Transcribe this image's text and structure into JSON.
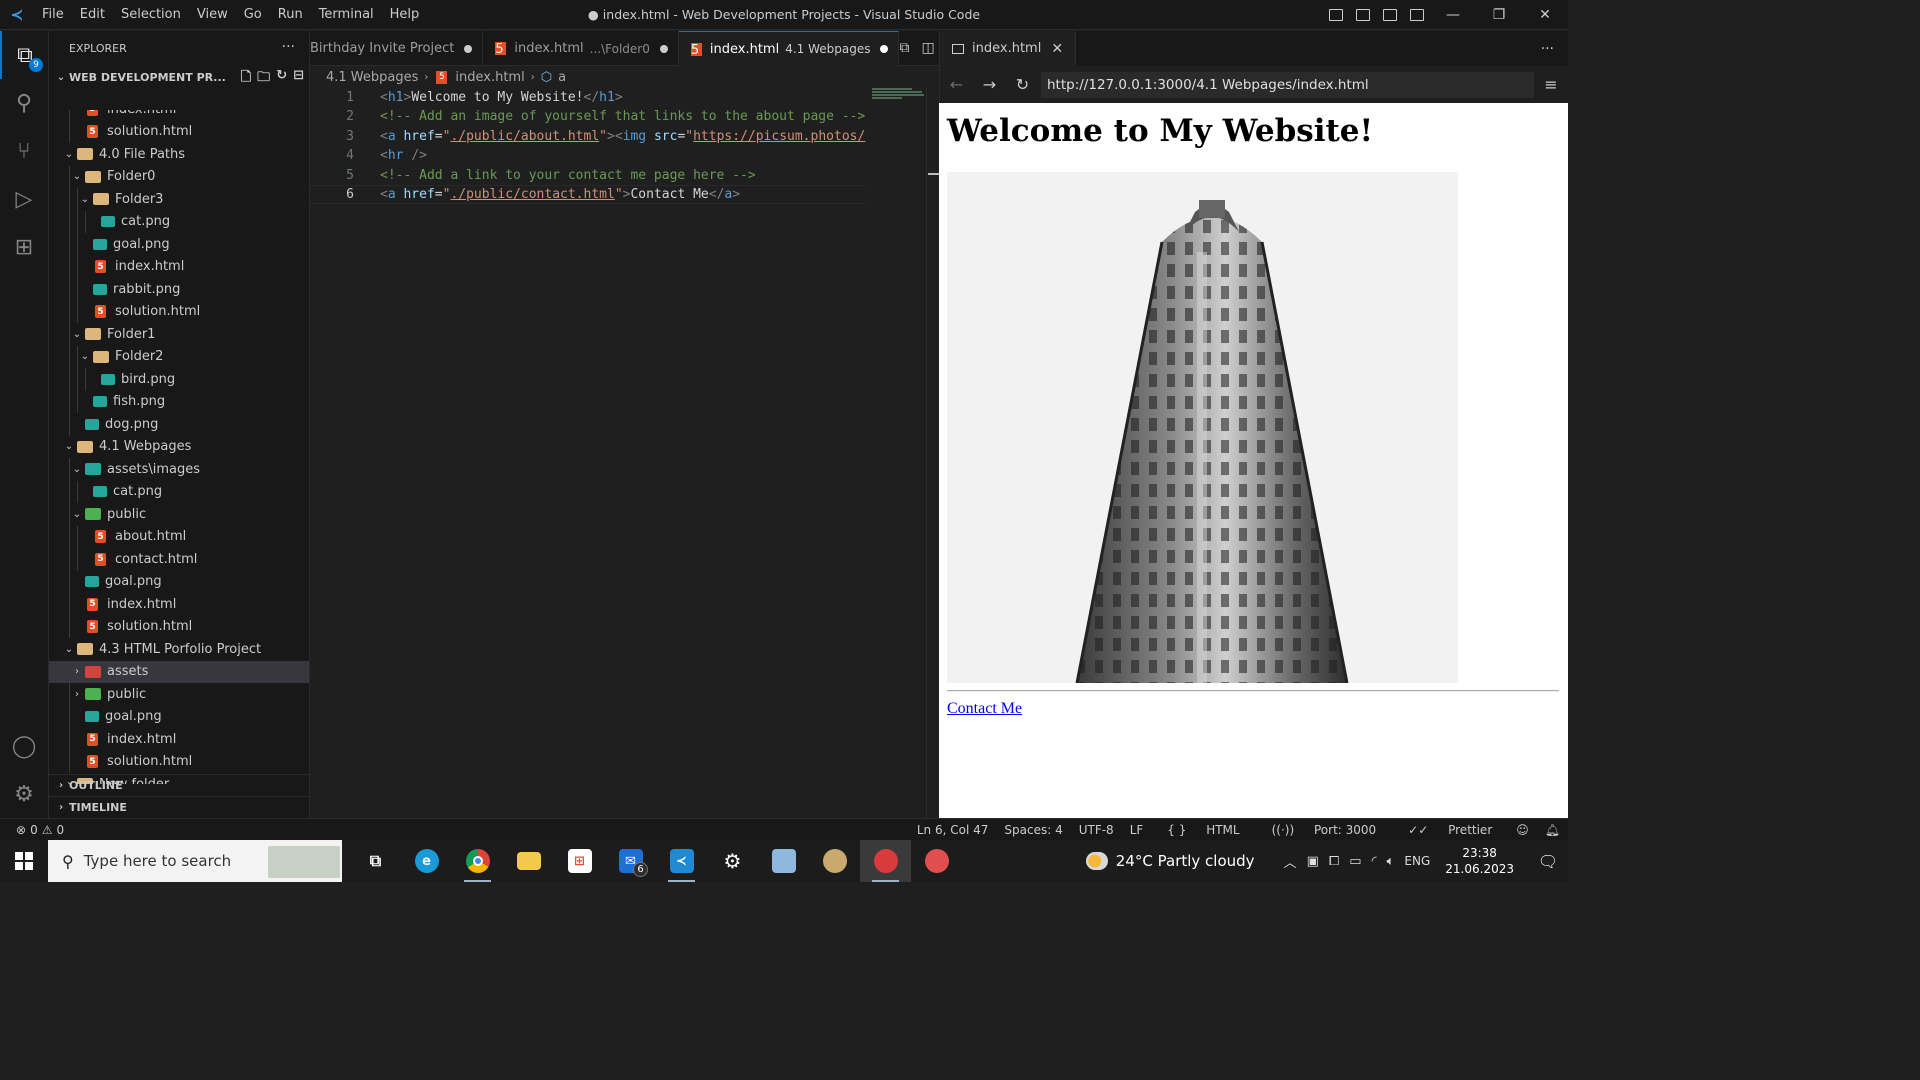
{
  "titlebar": {
    "menu": [
      "File",
      "Edit",
      "Selection",
      "View",
      "Go",
      "Run",
      "Terminal",
      "Help"
    ],
    "title": "● index.html - Web Development Projects - Visual Studio Code"
  },
  "activitybar": {
    "explorer_badge": "9",
    "items": [
      "files-icon",
      "search-icon",
      "source-control-icon",
      "run-debug-icon",
      "extensions-icon"
    ],
    "bottom_items": [
      "account-icon",
      "settings-gear-icon"
    ]
  },
  "sidebar": {
    "header": "EXPLORER",
    "more": "···",
    "section_title": "WEB DEVELOPMENT PR...",
    "tree": [
      {
        "label": "index.html",
        "type": "html",
        "depth": 2
      },
      {
        "label": "solution.html",
        "type": "html",
        "depth": 2
      },
      {
        "label": "4.0 File Paths",
        "type": "folder",
        "depth": 1,
        "open": true
      },
      {
        "label": "Folder0",
        "type": "folder",
        "depth": 2,
        "open": true
      },
      {
        "label": "Folder3",
        "type": "folder",
        "depth": 3,
        "open": true
      },
      {
        "label": "cat.png",
        "type": "png",
        "depth": 4
      },
      {
        "label": "goal.png",
        "type": "png",
        "depth": 3
      },
      {
        "label": "index.html",
        "type": "html",
        "depth": 3
      },
      {
        "label": "rabbit.png",
        "type": "png",
        "depth": 3
      },
      {
        "label": "solution.html",
        "type": "html",
        "depth": 3
      },
      {
        "label": "Folder1",
        "type": "folder",
        "depth": 2,
        "open": true
      },
      {
        "label": "Folder2",
        "type": "folder",
        "depth": 3,
        "open": true
      },
      {
        "label": "bird.png",
        "type": "png",
        "depth": 4
      },
      {
        "label": "fish.png",
        "type": "png",
        "depth": 3
      },
      {
        "label": "dog.png",
        "type": "png",
        "depth": 2
      },
      {
        "label": "4.1 Webpages",
        "type": "folder",
        "depth": 1,
        "open": true
      },
      {
        "label": "assets\\images",
        "type": "folder-t",
        "depth": 2,
        "open": true
      },
      {
        "label": "cat.png",
        "type": "png",
        "depth": 3
      },
      {
        "label": "public",
        "type": "folder-g",
        "depth": 2,
        "open": true
      },
      {
        "label": "about.html",
        "type": "html",
        "depth": 3
      },
      {
        "label": "contact.html",
        "type": "html",
        "depth": 3
      },
      {
        "label": "goal.png",
        "type": "png",
        "depth": 2
      },
      {
        "label": "index.html",
        "type": "html",
        "depth": 2
      },
      {
        "label": "solution.html",
        "type": "html",
        "depth": 2
      },
      {
        "label": "4.3 HTML Porfolio Project",
        "type": "folder",
        "depth": 1,
        "open": true
      },
      {
        "label": "assets",
        "type": "folder-r",
        "depth": 2,
        "open": false,
        "selected": true
      },
      {
        "label": "public",
        "type": "folder-g",
        "depth": 2,
        "open": false
      },
      {
        "label": "goal.png",
        "type": "png",
        "depth": 2
      },
      {
        "label": "index.html",
        "type": "html",
        "depth": 2
      },
      {
        "label": "solution.html",
        "type": "html",
        "depth": 2
      },
      {
        "label": "New folder",
        "type": "folder",
        "depth": 1,
        "open": false
      }
    ],
    "outline": "OUTLINE",
    "timeline": "TIMELINE"
  },
  "tabs": [
    {
      "label": "Birthday Invite Project",
      "desc": "",
      "dirty": true,
      "active": false,
      "html": false
    },
    {
      "label": "index.html",
      "desc": "...\\Folder0",
      "dirty": true,
      "active": false,
      "html": true
    },
    {
      "label": "index.html",
      "desc": "4.1 Webpages",
      "dirty": true,
      "active": true,
      "html": true
    }
  ],
  "breadcrumb": {
    "folder": "4.1 Webpages",
    "file": "index.html",
    "symbol": "a"
  },
  "code_lines": [
    {
      "n": "1",
      "tokens": [
        [
          "t-tag",
          "<"
        ],
        [
          "t-name",
          "h1"
        ],
        [
          "t-tag",
          ">"
        ],
        [
          "t-txt",
          "Welcome to My Website!"
        ],
        [
          "t-tag",
          "</"
        ],
        [
          "t-name",
          "h1"
        ],
        [
          "t-tag",
          ">"
        ]
      ]
    },
    {
      "n": "2",
      "tokens": [
        [
          "t-cmt",
          "<!-- Add an image of yourself that links to the about page -->"
        ]
      ]
    },
    {
      "n": "3",
      "tokens": [
        [
          "t-tag",
          "<"
        ],
        [
          "t-name",
          "a "
        ],
        [
          "t-attr",
          "href"
        ],
        [
          "t-txt",
          "="
        ],
        [
          "t-q",
          "\""
        ],
        [
          "t-str",
          "./public/about.html"
        ],
        [
          "t-q",
          "\""
        ],
        [
          "t-tag",
          "><"
        ],
        [
          "t-name",
          "img "
        ],
        [
          "t-attr",
          "src"
        ],
        [
          "t-txt",
          "="
        ],
        [
          "t-q",
          "\""
        ],
        [
          "t-str",
          "https://picsum.photos/"
        ]
      ]
    },
    {
      "n": "4",
      "tokens": [
        [
          "t-tag",
          "<"
        ],
        [
          "t-name",
          "hr "
        ],
        [
          "t-tag",
          "/>"
        ]
      ]
    },
    {
      "n": "5",
      "tokens": [
        [
          "t-cmt",
          "<!-- Add a link to your contact me page here -->"
        ]
      ]
    },
    {
      "n": "6",
      "tokens": [
        [
          "t-tag",
          "<"
        ],
        [
          "t-name",
          "a "
        ],
        [
          "t-attr",
          "href"
        ],
        [
          "t-txt",
          "="
        ],
        [
          "t-q",
          "\""
        ],
        [
          "t-str",
          "./public/contact.html"
        ],
        [
          "t-q",
          "\""
        ],
        [
          "t-tag",
          ">"
        ],
        [
          "t-txt",
          "Contact Me"
        ],
        [
          "t-tag",
          "</"
        ],
        [
          "t-name",
          "a"
        ],
        [
          "t-tag",
          ">"
        ]
      ],
      "current": true
    }
  ],
  "browser": {
    "tab_label": "index.html",
    "url": "http://127.0.0.1:3000/4.1 Webpages/index.html",
    "page": {
      "heading": "Welcome to My Website!",
      "link_text": "Contact Me"
    }
  },
  "statusbar": {
    "errors": "0",
    "warnings": "0",
    "position": "Ln 6, Col 47",
    "spaces": "Spaces: 4",
    "encoding": "UTF-8",
    "eol": "LF",
    "language": "HTML",
    "port": "Port: 3000",
    "prettier": "Prettier"
  },
  "taskbar": {
    "search_placeholder": "Type here to search",
    "mail_count": "6",
    "weather": "24°C  Partly cloudy",
    "language": "ENG",
    "time": "23:38",
    "date": "21.06.2023"
  },
  "colors": {
    "accent": "#0078d4",
    "html_icon": "#e44d26",
    "png_icon": "#26a69a",
    "folder": "#dcb67a"
  }
}
